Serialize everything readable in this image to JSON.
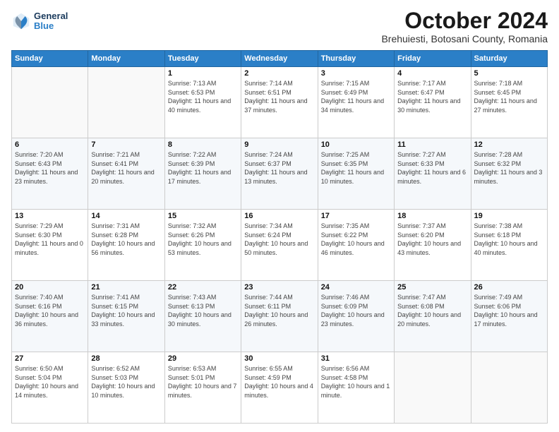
{
  "header": {
    "logo": {
      "general": "General",
      "blue": "Blue"
    },
    "title": "October 2024",
    "location": "Brehuiesti, Botosani County, Romania"
  },
  "weekdays": [
    "Sunday",
    "Monday",
    "Tuesday",
    "Wednesday",
    "Thursday",
    "Friday",
    "Saturday"
  ],
  "weeks": [
    [
      {
        "day": "",
        "info": ""
      },
      {
        "day": "",
        "info": ""
      },
      {
        "day": "1",
        "info": "Sunrise: 7:13 AM\nSunset: 6:53 PM\nDaylight: 11 hours and 40 minutes."
      },
      {
        "day": "2",
        "info": "Sunrise: 7:14 AM\nSunset: 6:51 PM\nDaylight: 11 hours and 37 minutes."
      },
      {
        "day": "3",
        "info": "Sunrise: 7:15 AM\nSunset: 6:49 PM\nDaylight: 11 hours and 34 minutes."
      },
      {
        "day": "4",
        "info": "Sunrise: 7:17 AM\nSunset: 6:47 PM\nDaylight: 11 hours and 30 minutes."
      },
      {
        "day": "5",
        "info": "Sunrise: 7:18 AM\nSunset: 6:45 PM\nDaylight: 11 hours and 27 minutes."
      }
    ],
    [
      {
        "day": "6",
        "info": "Sunrise: 7:20 AM\nSunset: 6:43 PM\nDaylight: 11 hours and 23 minutes."
      },
      {
        "day": "7",
        "info": "Sunrise: 7:21 AM\nSunset: 6:41 PM\nDaylight: 11 hours and 20 minutes."
      },
      {
        "day": "8",
        "info": "Sunrise: 7:22 AM\nSunset: 6:39 PM\nDaylight: 11 hours and 17 minutes."
      },
      {
        "day": "9",
        "info": "Sunrise: 7:24 AM\nSunset: 6:37 PM\nDaylight: 11 hours and 13 minutes."
      },
      {
        "day": "10",
        "info": "Sunrise: 7:25 AM\nSunset: 6:35 PM\nDaylight: 11 hours and 10 minutes."
      },
      {
        "day": "11",
        "info": "Sunrise: 7:27 AM\nSunset: 6:33 PM\nDaylight: 11 hours and 6 minutes."
      },
      {
        "day": "12",
        "info": "Sunrise: 7:28 AM\nSunset: 6:32 PM\nDaylight: 11 hours and 3 minutes."
      }
    ],
    [
      {
        "day": "13",
        "info": "Sunrise: 7:29 AM\nSunset: 6:30 PM\nDaylight: 11 hours and 0 minutes."
      },
      {
        "day": "14",
        "info": "Sunrise: 7:31 AM\nSunset: 6:28 PM\nDaylight: 10 hours and 56 minutes."
      },
      {
        "day": "15",
        "info": "Sunrise: 7:32 AM\nSunset: 6:26 PM\nDaylight: 10 hours and 53 minutes."
      },
      {
        "day": "16",
        "info": "Sunrise: 7:34 AM\nSunset: 6:24 PM\nDaylight: 10 hours and 50 minutes."
      },
      {
        "day": "17",
        "info": "Sunrise: 7:35 AM\nSunset: 6:22 PM\nDaylight: 10 hours and 46 minutes."
      },
      {
        "day": "18",
        "info": "Sunrise: 7:37 AM\nSunset: 6:20 PM\nDaylight: 10 hours and 43 minutes."
      },
      {
        "day": "19",
        "info": "Sunrise: 7:38 AM\nSunset: 6:18 PM\nDaylight: 10 hours and 40 minutes."
      }
    ],
    [
      {
        "day": "20",
        "info": "Sunrise: 7:40 AM\nSunset: 6:16 PM\nDaylight: 10 hours and 36 minutes."
      },
      {
        "day": "21",
        "info": "Sunrise: 7:41 AM\nSunset: 6:15 PM\nDaylight: 10 hours and 33 minutes."
      },
      {
        "day": "22",
        "info": "Sunrise: 7:43 AM\nSunset: 6:13 PM\nDaylight: 10 hours and 30 minutes."
      },
      {
        "day": "23",
        "info": "Sunrise: 7:44 AM\nSunset: 6:11 PM\nDaylight: 10 hours and 26 minutes."
      },
      {
        "day": "24",
        "info": "Sunrise: 7:46 AM\nSunset: 6:09 PM\nDaylight: 10 hours and 23 minutes."
      },
      {
        "day": "25",
        "info": "Sunrise: 7:47 AM\nSunset: 6:08 PM\nDaylight: 10 hours and 20 minutes."
      },
      {
        "day": "26",
        "info": "Sunrise: 7:49 AM\nSunset: 6:06 PM\nDaylight: 10 hours and 17 minutes."
      }
    ],
    [
      {
        "day": "27",
        "info": "Sunrise: 6:50 AM\nSunset: 5:04 PM\nDaylight: 10 hours and 14 minutes."
      },
      {
        "day": "28",
        "info": "Sunrise: 6:52 AM\nSunset: 5:03 PM\nDaylight: 10 hours and 10 minutes."
      },
      {
        "day": "29",
        "info": "Sunrise: 6:53 AM\nSunset: 5:01 PM\nDaylight: 10 hours and 7 minutes."
      },
      {
        "day": "30",
        "info": "Sunrise: 6:55 AM\nSunset: 4:59 PM\nDaylight: 10 hours and 4 minutes."
      },
      {
        "day": "31",
        "info": "Sunrise: 6:56 AM\nSunset: 4:58 PM\nDaylight: 10 hours and 1 minute."
      },
      {
        "day": "",
        "info": ""
      },
      {
        "day": "",
        "info": ""
      }
    ]
  ]
}
